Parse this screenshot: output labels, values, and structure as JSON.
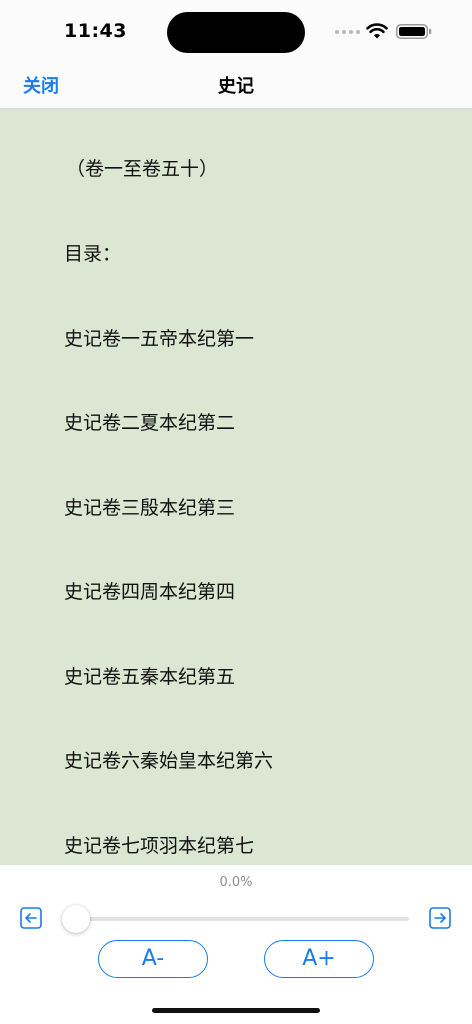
{
  "status_bar": {
    "time": "11:43"
  },
  "nav": {
    "close_label": "关闭",
    "title": "史记"
  },
  "content": {
    "lines": [
      "（卷一至卷五十）",
      "目录：",
      "史记卷一五帝本纪第一",
      "史记卷二夏本纪第二",
      "史记卷三殷本纪第三",
      "史记卷四周本纪第四",
      "史记卷五秦本纪第五",
      "史记卷六秦始皇本纪第六",
      "史记卷七项羽本纪第七"
    ]
  },
  "controls": {
    "progress_text": "0.0%",
    "progress_fraction": 0.0,
    "prev_icon": "arrow-left-square-icon",
    "next_icon": "arrow-right-square-icon",
    "font_decrease_label": "A-",
    "font_increase_label": "A+"
  },
  "colors": {
    "accent": "#1a7cf0",
    "reading_background": "#dce7d3"
  }
}
